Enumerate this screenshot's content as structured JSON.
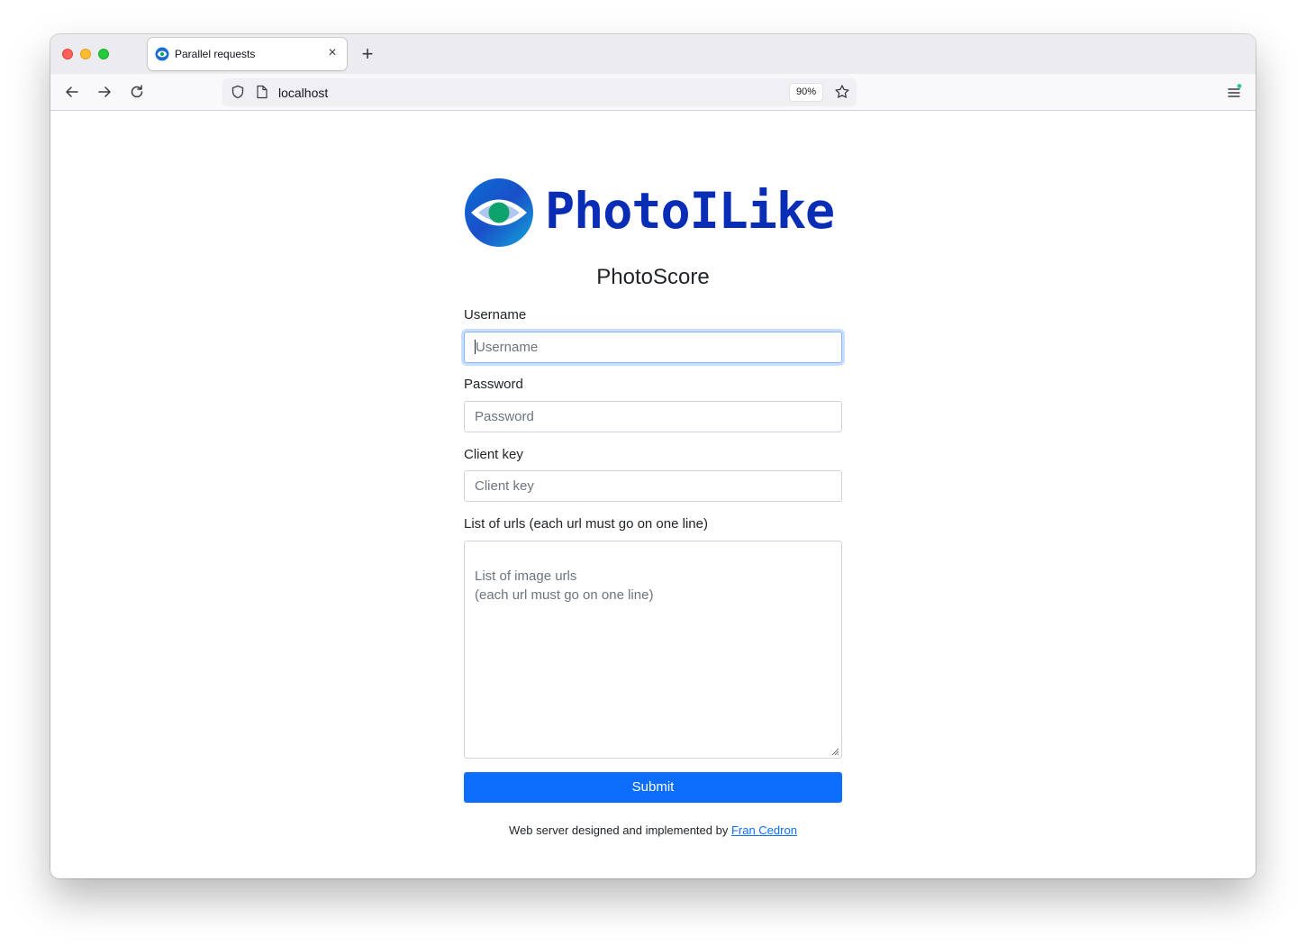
{
  "browser": {
    "tab_title": "Parallel requests",
    "tab_close_glyph": "×",
    "new_tab_glyph": "+",
    "url": "localhost",
    "zoom": "90%",
    "icons": [
      "back-arrow-icon",
      "forward-arrow-icon",
      "reload-icon",
      "shield-icon",
      "page-icon",
      "star-icon",
      "hamburger-menu-icon"
    ]
  },
  "page": {
    "logo_text": "PhotoILike",
    "title": "PhotoScore",
    "fields": {
      "username": {
        "label": "Username",
        "placeholder": "Username",
        "value": ""
      },
      "password": {
        "label": "Password",
        "placeholder": "Password",
        "value": ""
      },
      "client_key": {
        "label": "Client key",
        "placeholder": "Client key",
        "value": ""
      },
      "urls": {
        "label": "List of urls (each url must go on one line)",
        "placeholder": "List of image urls\n(each url must go on one line)",
        "value": ""
      }
    },
    "submit_label": "Submit",
    "footer": {
      "text": "Web server designed and implemented by ",
      "link_text": "Fran Cedron"
    }
  },
  "colors": {
    "brand": "#0a2db5",
    "primary_button": "#0d6efd",
    "logo_green": "#0ea36a",
    "logo_blue": "#1b6fd1"
  }
}
